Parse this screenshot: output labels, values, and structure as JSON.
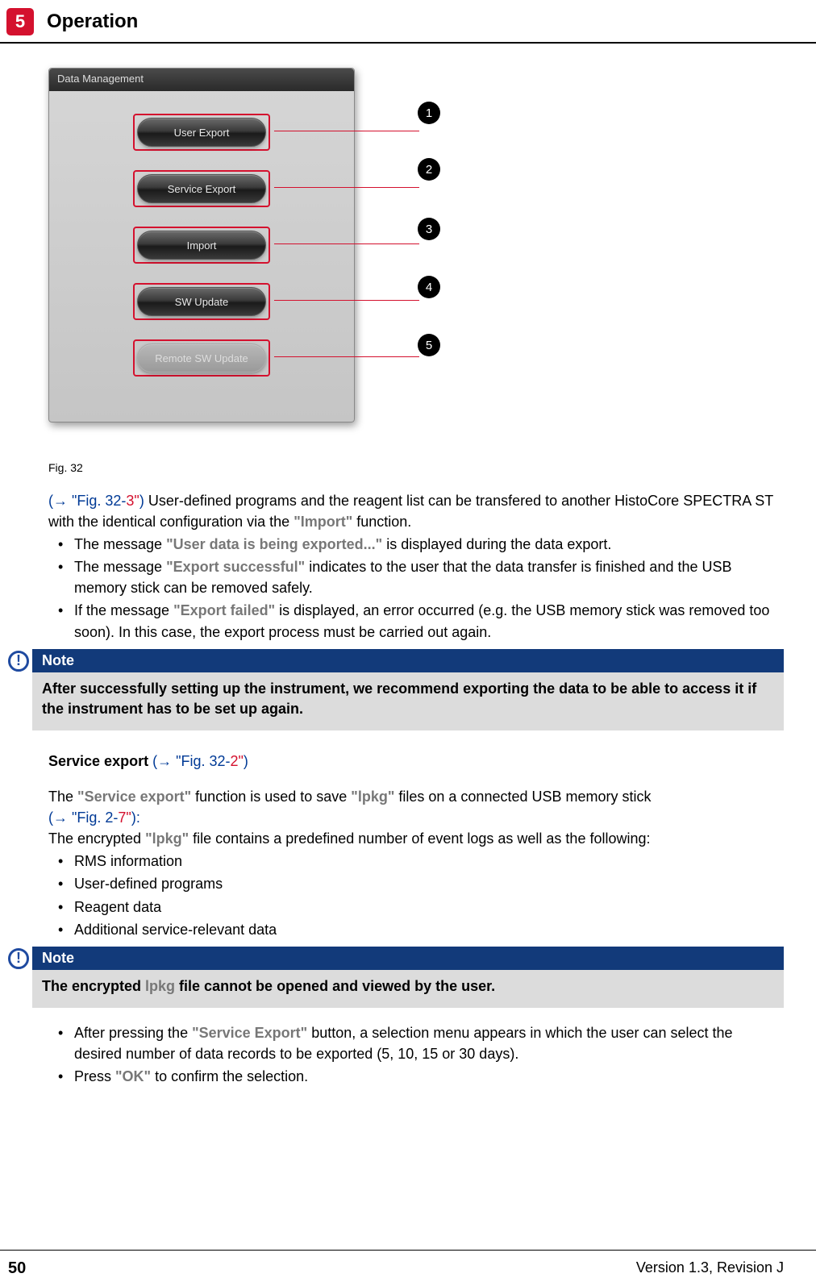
{
  "header": {
    "chapter_number": "5",
    "chapter_title": "Operation"
  },
  "figure": {
    "window_title": "Data Management",
    "buttons": {
      "b1": "User Export",
      "b2": "Service Export",
      "b3": "Import",
      "b4": "SW Update",
      "b5": "Remote SW Update"
    },
    "callouts": {
      "c1": "1",
      "c2": "2",
      "c3": "3",
      "c4": "4",
      "c5": "5"
    },
    "caption": "Fig. 32"
  },
  "para1": {
    "ref_prefix": "(→ ",
    "ref_fig": "\"Fig. 32",
    "ref_dash": "-",
    "ref_num": "3\"",
    "ref_suffix": ") ",
    "t1": "User-defined programs and the reagent list can be transfered to another HistoCore SPECTRA ST with the identical configuration via the ",
    "import_word": "\"Import\"",
    "t2": " function."
  },
  "list1": {
    "i1a": "The message ",
    "i1b": "\"User data is being exported...\"",
    "i1c": " is displayed during the data export.",
    "i2a": "The message ",
    "i2b": "\"Export successful\"",
    "i2c": " indicates to the user that the data transfer is finished and the USB memory stick can be removed safely.",
    "i3a": "If the message ",
    "i3b": "\"Export failed\"",
    "i3c": " is displayed, an error occurred (e.g. the USB memory stick was removed too soon). In this case, the export process must be carried out again."
  },
  "note1": {
    "label": "Note",
    "body": "After successfully setting up the instrument, we recommend exporting the data to be able to access it if the instrument has to be set up again."
  },
  "section2": {
    "title": "Service export ",
    "ref_prefix": "(→ ",
    "ref_fig": "\"Fig. 32",
    "ref_dash": "-",
    "ref_num": "2\"",
    "ref_suffix": ")"
  },
  "para2": {
    "t1": "The ",
    "se": "\"Service export\"",
    "t2": " function is used to save ",
    "lpkg": "\"lpkg\"",
    "t3": " files on a connected USB memory stick ",
    "ref_prefix": "(→ ",
    "ref_fig": "\"Fig. 2",
    "ref_dash": "-",
    "ref_num": "7\"",
    "ref_suffix": "):",
    "line2a": "The encrypted ",
    "line2b": "\"lpkg\"",
    "line2c": " file contains a predefined number of event logs as well as the following:"
  },
  "list2": {
    "i1": "RMS information",
    "i2": "User-defined programs",
    "i3": "Reagent data",
    "i4": "Additional service-relevant data"
  },
  "note2": {
    "label": "Note",
    "body_a": "The encrypted ",
    "body_b": "lpkg",
    "body_c": " file cannot be opened and viewed by the user."
  },
  "list3": {
    "i1a": "After pressing the ",
    "i1b": "\"Service Export\"",
    "i1c": " button, a selection menu appears in which the user can select the desired number of data records to be exported (5, 10, 15 or 30 days).",
    "i2a": "Press ",
    "i2b": "\"OK\"",
    "i2c": " to confirm the selection."
  },
  "footer": {
    "page": "50",
    "version": "Version 1.3, Revision J"
  }
}
